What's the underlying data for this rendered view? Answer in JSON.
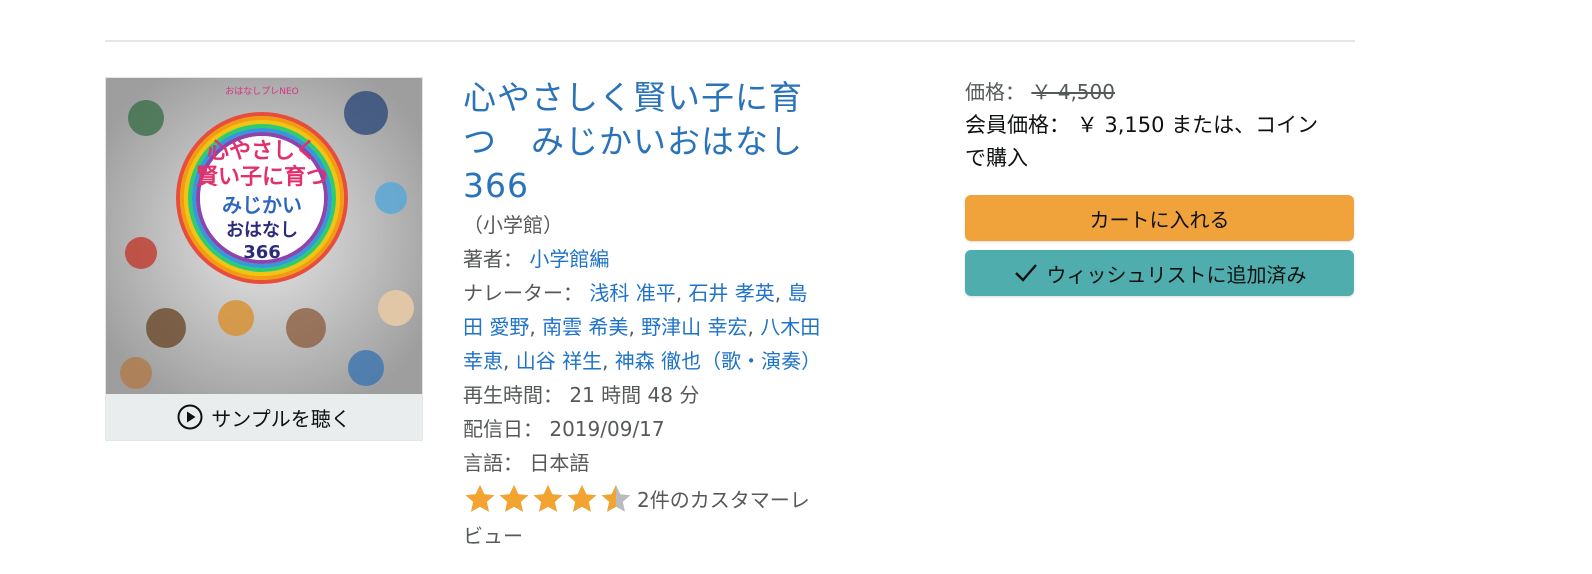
{
  "product": {
    "title_lines": [
      "心やさしく賢い子に育",
      "つ　みじかいおはなし",
      "366"
    ],
    "publisher": "（小学館）",
    "author_label": "著者：",
    "author": "小学館編",
    "narrator_label": "ナレーター：",
    "narrator_lines": [
      [
        "浅科 准平",
        "石井 孝英",
        "島"
      ],
      [
        "田 愛野",
        "南雲 希美",
        "野津山 幸宏",
        "八木田"
      ],
      [
        "幸恵",
        "山谷 祥生",
        "神森 徹也（歌・演奏）"
      ]
    ],
    "runtime_label": "再生時間：",
    "runtime": "21 時間 48 分",
    "release_label": "配信日：",
    "release_date": "2019/09/17",
    "language_label": "言語：",
    "language": "日本語",
    "rating_stars": 4.5,
    "review_text_1": "2件のカスタマーレ",
    "review_text_2": "ビュー",
    "sample_label": "サンプルを聴く"
  },
  "cover": {
    "series_label": "おはなしプレNEO",
    "title_1": "心やさしく",
    "title_2": "賢い子に育つ",
    "title_3": "みじかい",
    "title_4": "おはなし",
    "title_5": "366"
  },
  "buy_box": {
    "price_label": "価格：",
    "list_price": "￥ 4,500",
    "member_label": "会員価格：",
    "member_price": "￥ 3,150",
    "member_suffix": " または、コイン",
    "member_suffix_2": "で購入",
    "cart_button": "カートに入れる",
    "wishlist_button": "ウィッシュリストに追加済み"
  },
  "colors": {
    "link": "#1f73c8",
    "title": "#2a73b8",
    "cart_button": "#f0a23b",
    "wishlist_button": "#4fadad",
    "star": "#f3a32f"
  },
  "icons": [
    "play-icon",
    "check-icon",
    "star-icon"
  ]
}
